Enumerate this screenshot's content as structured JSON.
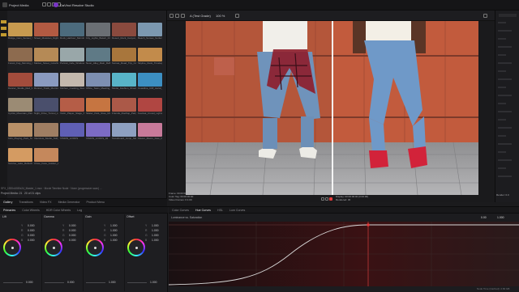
{
  "topbar": {
    "title": "DaVinci Resolve Studio",
    "browser_dropdown": "Project Media"
  },
  "viewer": {
    "zoom": "100 %",
    "dropdown": "A (Test Grade)",
    "timecode_info_left1": "Frame: 00:00:00:00 (1:1)",
    "timecode_info_left2": "Color Tag: 00:00:00:00",
    "timecode_info_left3": "Video Frames: 0:1:00",
    "timecode_info_right1": "Frame: 1/360",
    "timecode_info_right2": "Display: 00:00:00:00 (0:00:00)",
    "timecode_info_right3": "Rendered: 30",
    "right_label": "Render: 0.0"
  },
  "browser": {
    "footer_left": "Project Media: 21",
    "footer_right": "20 of 21 clips",
    "path": "SFX_1920x1080x24_Master_1.mov   ·   Movie Timeline Node   ·   None (progressive scan) ..."
  },
  "media_clips": [
    {
      "label": "Bridge_Cam_Sunset_Wide_04",
      "color": "#c79a4f"
    },
    {
      "label": "Street_Musician_Night_Crowd",
      "color": "#b25a42"
    },
    {
      "label": "Dock_Harbour_Morning_Haze",
      "color": "#4c6b7d"
    },
    {
      "label": "City_Lights_Bokeh_Drive",
      "color": "#6b6f74"
    },
    {
      "label": "Desert_Rock_Canyon_Drone",
      "color": "#8a4a3e"
    },
    {
      "label": "Beach_Sunset_Surfers_Gold",
      "color": "#7c98b0"
    },
    {
      "label": "Forest_Fog_Morning_Drone",
      "color": "#8d6b4f"
    },
    {
      "label": "Market_Street_Colorful_Day",
      "color": "#b58a56"
    },
    {
      "label": "Portrait_Cafe_Window_Light",
      "color": "#99a7a9"
    },
    {
      "label": "Neon_Alley_Rain_Reflect",
      "color": "#5f7a86"
    },
    {
      "label": "Sunset_Road_Trip_Convertible",
      "color": "#a8763c"
    },
    {
      "label": "Skyline_Dusk_Timelapse_01",
      "color": "#c28b4b"
    },
    {
      "label": "Dancer_Studio_Red_Wall",
      "color": "#a34c3c"
    },
    {
      "label": "Runner_Track_Morning_Side",
      "color": "#8a9abf"
    },
    {
      "label": "Kitchen_Cooking_Steam_Close",
      "color": "#c3b8ad"
    },
    {
      "label": "Office_Team_Meeting_Wide",
      "color": "#7d8fb1"
    },
    {
      "label": "Model_Fashion_Shoot_Teal",
      "color": "#58b4c8"
    },
    {
      "label": "Coastline_Cliff_Aerial_Blue",
      "color": "#3c8fc2"
    },
    {
      "label": "Cyclist_Mountain_Pass_Sun",
      "color": "#9b8b74"
    },
    {
      "label": "Night_Drive_Tunnel_Lights",
      "color": "#4a4f6c"
    },
    {
      "label": "Violin_Player_Stage_Spot",
      "color": "#b55d47"
    },
    {
      "label": "Skater_Park_Slow_Motion",
      "color": "#c67541"
    },
    {
      "label": "Friends_Rooftop_Party_Warm",
      "color": "#ab5948"
    },
    {
      "label": "Festival_Crowd_Lights_Night",
      "color": "#b04642"
    },
    {
      "label": "Kids_Playing_Park_Sunny",
      "color": "#b99168"
    },
    {
      "label": "Interview_Studio_Soft_Key",
      "color": "#9f7e63"
    },
    {
      "label": "VISION_LOOKS",
      "color": "#5f5fb4"
    },
    {
      "label": "VISION_LOOKS_02",
      "color": "#7c6bc4"
    },
    {
      "label": "Snowboard_Jump_Slow",
      "color": "#8ea0c1"
    },
    {
      "label": "Flower_Macro_Dew_Drops",
      "color": "#c87a9a"
    },
    {
      "label": "Sunrise_Lake_Reflection",
      "color": "#d49b62"
    },
    {
      "label": "Close_Face_Golden_Hour",
      "color": "#c5885c"
    }
  ],
  "tabs_row": [
    "Gallery",
    "Transitions",
    "Video FX",
    "Media Generator",
    "Product Menu"
  ],
  "bottom": {
    "left_header": [
      "Primaries",
      "Color Wheels",
      "HDR Color Wheels",
      "Log"
    ],
    "lum_mix_label": "Lum Mix",
    "wheels": [
      {
        "name": "Lift",
        "values": [
          "0.000",
          "0.000",
          "0.000",
          "0.000"
        ],
        "bottom": "0.000"
      },
      {
        "name": "Gamma",
        "values": [
          "0.000",
          "0.000",
          "0.000",
          "0.000"
        ],
        "bottom": "0.000"
      },
      {
        "name": "Gain",
        "values": [
          "1.000",
          "1.000",
          "1.000",
          "1.000"
        ],
        "bottom": "1.000"
      },
      {
        "name": "Offset",
        "values": [
          "1.000",
          "1.000",
          "1.000",
          "1.000"
        ],
        "bottom": "1.000"
      }
    ],
    "channel_labels": [
      "Y",
      "R",
      "G",
      "B"
    ],
    "curves_tabs": [
      "Color Curves",
      "Hue Curves",
      "HSL",
      "Lum Curves"
    ],
    "curves_dropdown": "Luminance vs. Saturation",
    "curves_value1": "0.00",
    "curves_value2": "1.000",
    "footer_status": "Node Time (Cached): 2.84 GB"
  },
  "colors": {
    "accent": "#e33b3b",
    "wall_left": "#b65636",
    "wall_right": "#c45a3a"
  }
}
